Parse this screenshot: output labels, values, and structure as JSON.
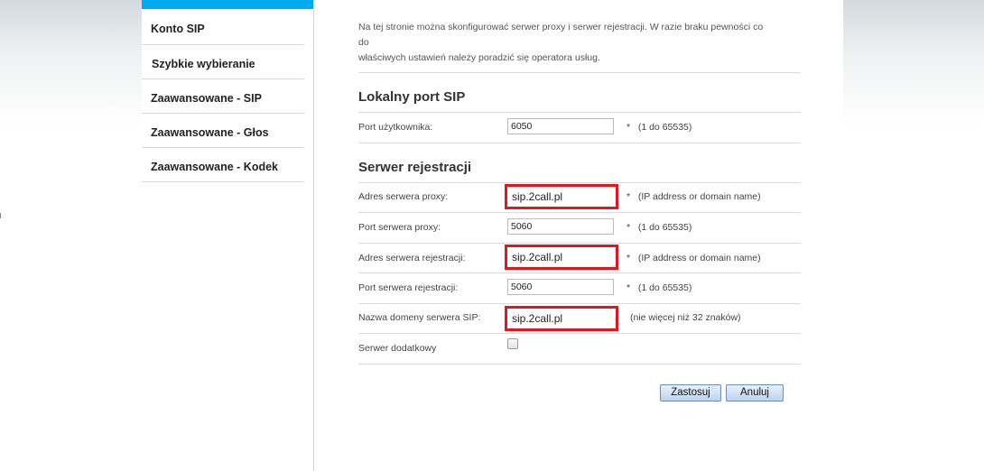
{
  "sidebar": {
    "items": [
      {
        "label": "Konto SIP"
      },
      {
        "label": "Szybkie wybieranie"
      },
      {
        "label": "Zaawansowane - SIP"
      },
      {
        "label": "Zaawansowane - Głos"
      },
      {
        "label": "Zaawansowane - Kodek"
      }
    ]
  },
  "intro": {
    "line1": "Na tej stronie można skonfigurować serwer proxy i serwer rejestracji. W razie braku pewności co do",
    "line2": "właściwych ustawień należy poradzić się operatora usług."
  },
  "local_port": {
    "title": "Lokalny port SIP",
    "user_port_label": "Port użytkownika:",
    "user_port_value": "6050",
    "user_port_hint": "*   (1 do 65535)"
  },
  "registration": {
    "title": "Serwer rejestracji",
    "proxy_addr_label": "Adres serwera proxy:",
    "proxy_addr_value": "sip.2call.pl",
    "proxy_addr_hint": "*   (IP address or domain name)",
    "proxy_port_label": "Port serwera proxy:",
    "proxy_port_value": "5060",
    "proxy_port_hint": "*   (1 do 65535)",
    "reg_addr_label": "Adres serwera rejestracji:",
    "reg_addr_value": "sip.2call.pl",
    "reg_addr_hint": "*   (IP address or domain name)",
    "reg_port_label": "Port serwera rejestracji:",
    "reg_port_value": "5060",
    "reg_port_hint": "*   (1 do 65535)",
    "domain_label": "Nazwa domeny serwera SIP:",
    "domain_value": "sip.2call.pl",
    "domain_hint": "(nie więcej niż 32 znaków)",
    "secondary_label": "Serwer dodatkowy",
    "secondary_checked": false
  },
  "buttons": {
    "apply": "Zastosuj",
    "cancel": "Anuluj"
  },
  "colors": {
    "accent_bar": "#00aaee",
    "highlight": "#e0171f"
  }
}
